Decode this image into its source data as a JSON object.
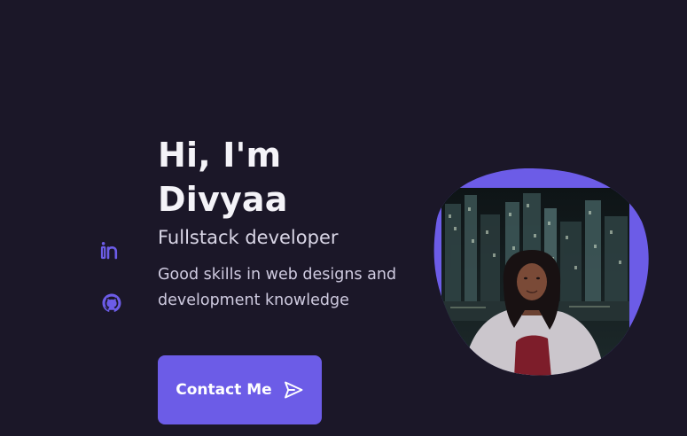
{
  "hero": {
    "title_line1": "Hi, I'm",
    "title_line2": "Divyaa",
    "subtitle": "Fullstack developer",
    "description": "Good skills in web designs and development knowledge",
    "contact_label": "Contact Me"
  },
  "social": {
    "linkedin_icon": "linkedin-icon",
    "github_icon": "github-icon"
  },
  "icons": {
    "button_icon": "send-icon"
  },
  "colors": {
    "background": "#1b1728",
    "accent": "#6c5ce7",
    "text": "#f4f3f8"
  }
}
